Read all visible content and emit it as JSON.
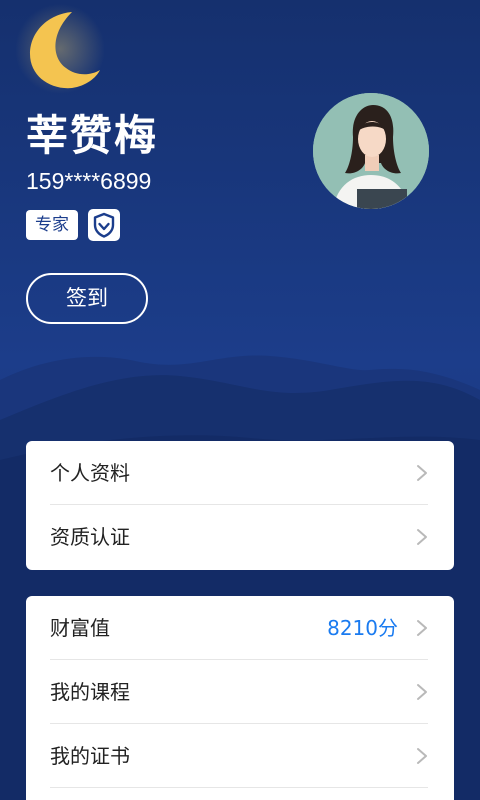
{
  "profile": {
    "name": "莘赞梅",
    "phone": "159****6899",
    "badge_label": "专家",
    "verified_icon": "shield-check-icon",
    "signin_label": "签到"
  },
  "menu_group_1": {
    "items": [
      {
        "label": "个人资料"
      },
      {
        "label": "资质认证"
      }
    ]
  },
  "menu_group_2": {
    "items": [
      {
        "label": "财富值",
        "value": "8210分"
      },
      {
        "label": "我的课程"
      },
      {
        "label": "我的证书"
      }
    ]
  },
  "colors": {
    "background": "#132e6b",
    "accent_value": "#1a7bf0",
    "moon": "#f4c450"
  }
}
